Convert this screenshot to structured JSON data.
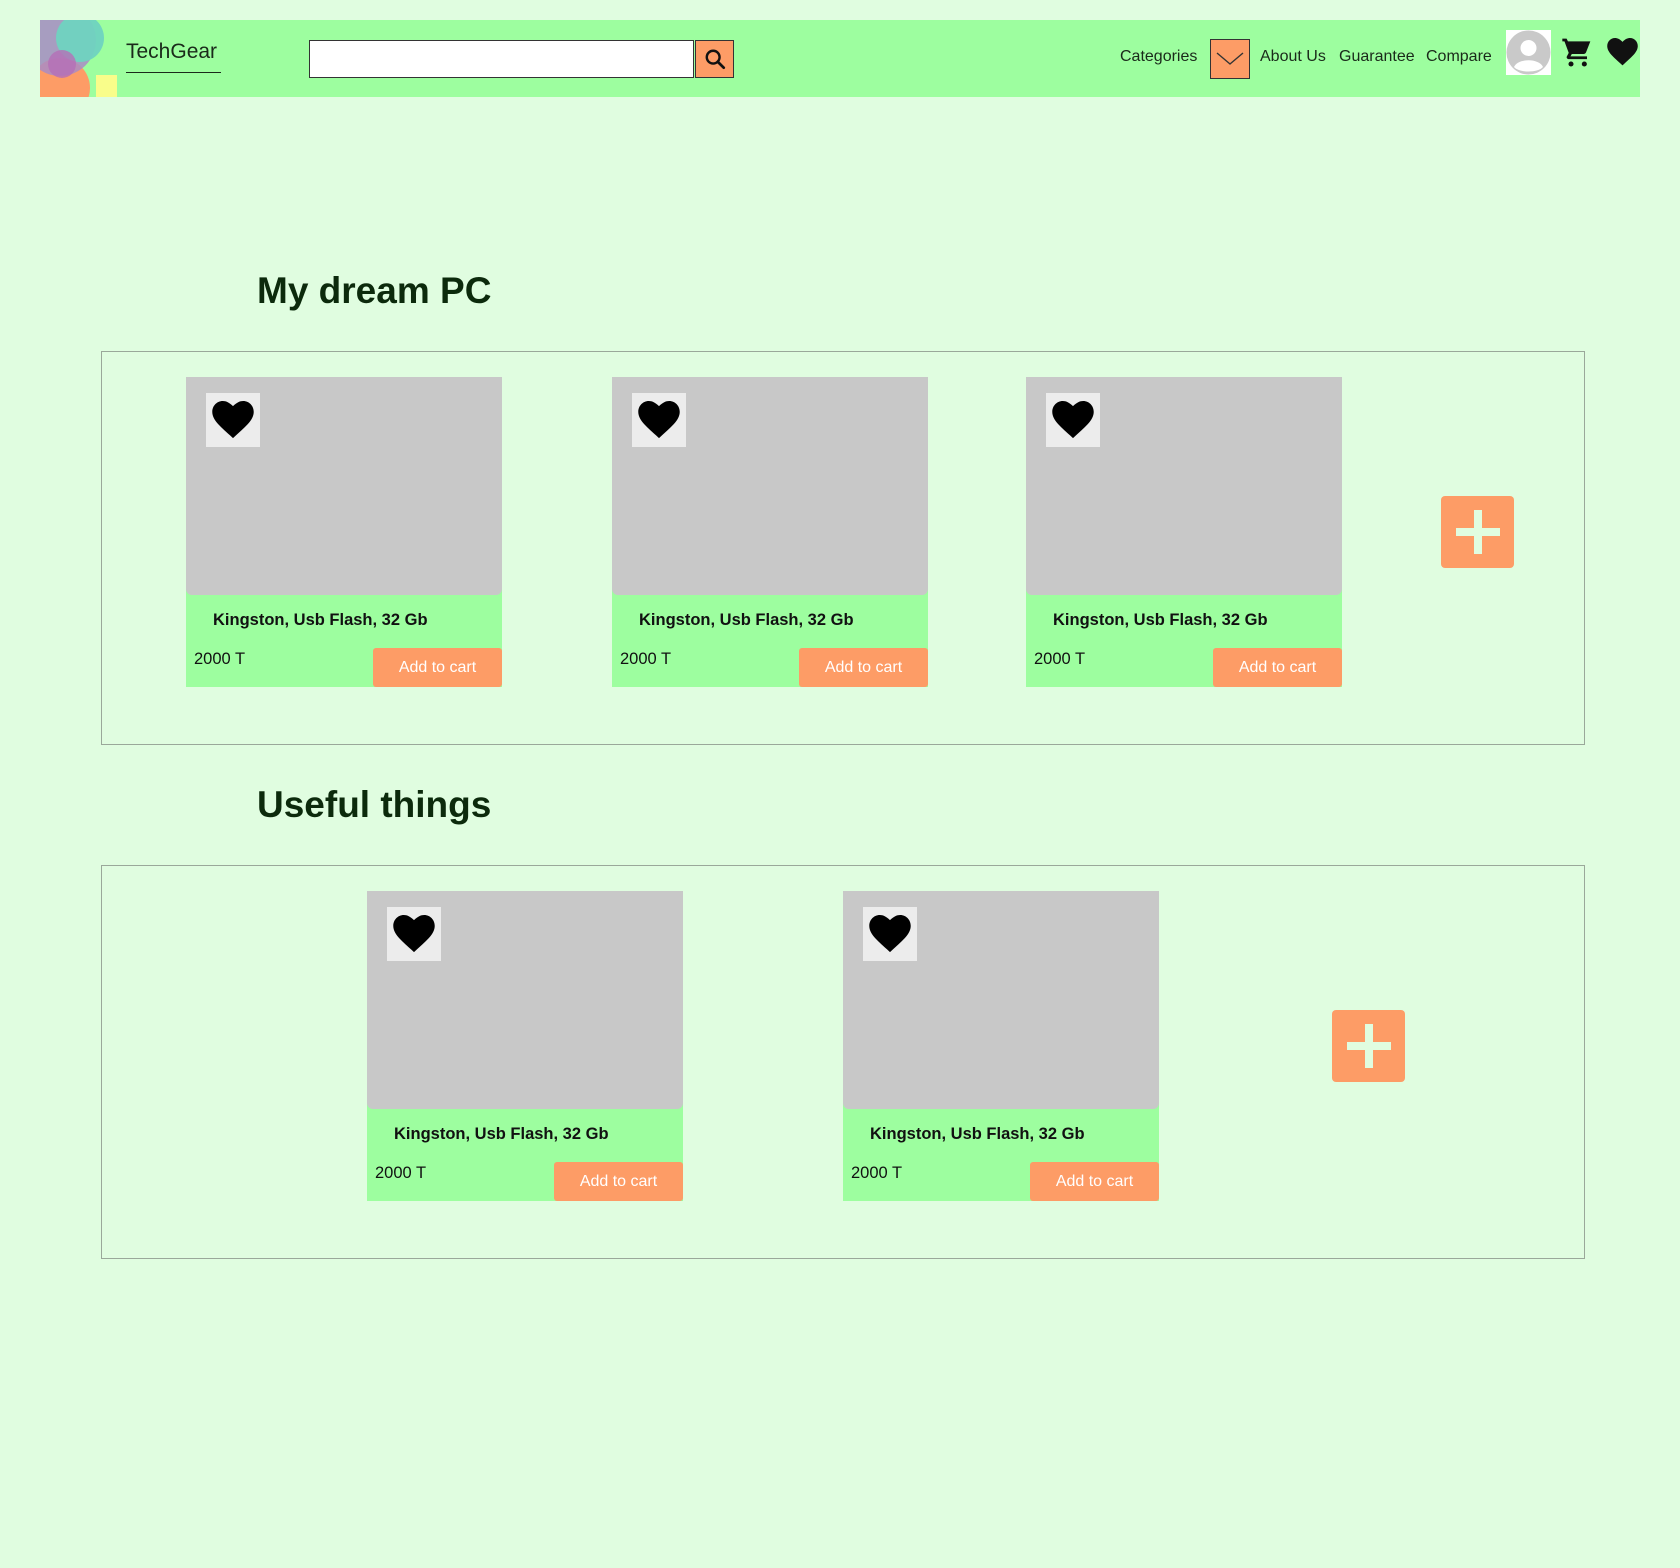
{
  "header": {
    "brand": "TechGear",
    "search": {
      "value": "",
      "placeholder": ""
    },
    "nav": {
      "categories": "Categories",
      "about": "About Us",
      "guarantee": "Guarantee",
      "compare": "Compare"
    }
  },
  "sections": [
    {
      "title": "My dream PC",
      "products": [
        {
          "name": "Kingston, Usb Flash, 32 Gb",
          "price": "2000 T",
          "button": "Add to cart"
        },
        {
          "name": "Kingston, Usb Flash, 32 Gb",
          "price": "2000 T",
          "button": "Add to cart"
        },
        {
          "name": "Kingston, Usb Flash, 32 Gb",
          "price": "2000 T",
          "button": "Add to cart"
        }
      ]
    },
    {
      "title": "Useful things",
      "products": [
        {
          "name": "Kingston, Usb Flash, 32 Gb",
          "price": "2000 T",
          "button": "Add to cart"
        },
        {
          "name": "Kingston, Usb Flash, 32 Gb",
          "price": "2000 T",
          "button": "Add to cart"
        }
      ]
    }
  ],
  "icons": {
    "search": "search-icon",
    "categories_toggle": "chevron-down-icon",
    "avatar": "user-avatar-icon",
    "cart": "cart-icon",
    "favorites": "heart-icon",
    "add": "plus-icon"
  },
  "colors": {
    "background": "#e0fde0",
    "header": "#9dfe9f",
    "accent": "#fd9c66",
    "card": "#9dfe9f",
    "image_placeholder": "#c8c8c8"
  }
}
